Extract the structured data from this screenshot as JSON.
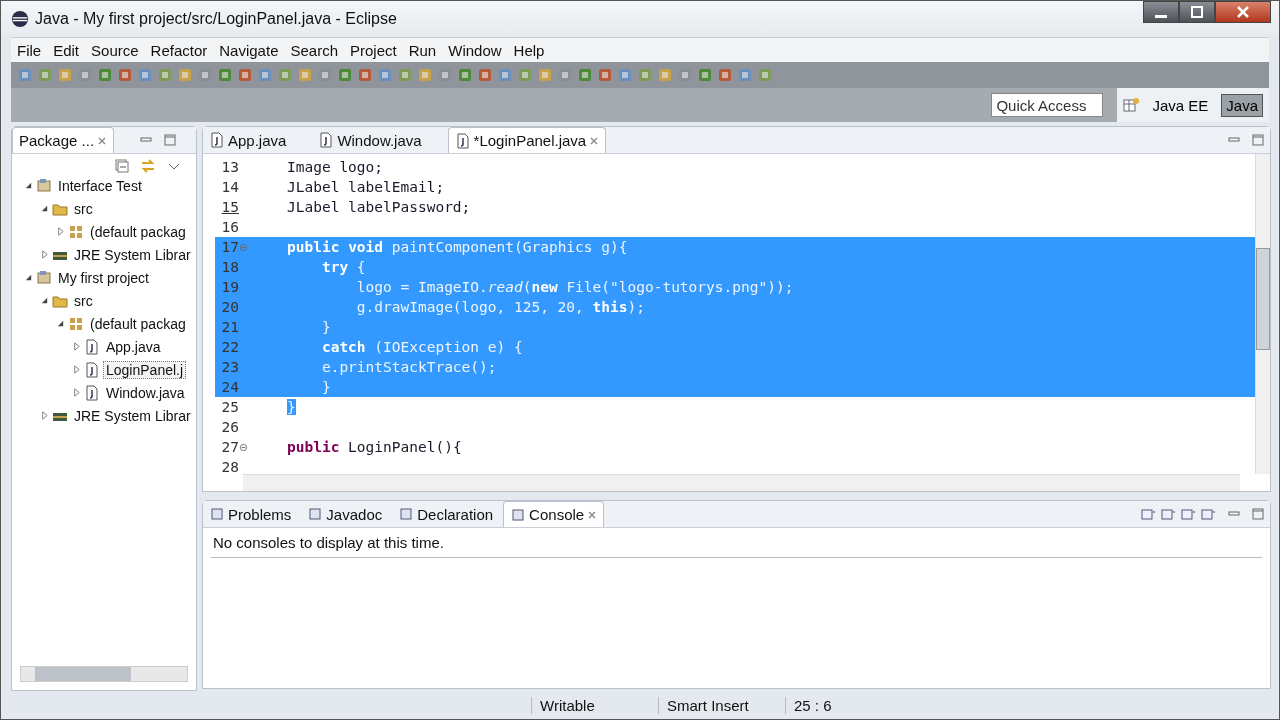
{
  "window": {
    "title": "Java - My first project/src/LoginPanel.java - Eclipse"
  },
  "menu": [
    "File",
    "Edit",
    "Source",
    "Refactor",
    "Navigate",
    "Search",
    "Project",
    "Run",
    "Window",
    "Help"
  ],
  "quick_access": {
    "placeholder": "Quick Access"
  },
  "perspectives": [
    {
      "label": "Java EE",
      "selected": false
    },
    {
      "label": "Java",
      "selected": true
    }
  ],
  "package_explorer": {
    "title": "Package ...",
    "tree": [
      {
        "label": "Interface Test",
        "kind": "project",
        "expanded": true,
        "selected": false,
        "children": [
          {
            "label": "src",
            "kind": "source",
            "expanded": true,
            "selected": false,
            "children": [
              {
                "label": "(default packag",
                "kind": "package",
                "expanded": false,
                "selected": false
              }
            ]
          },
          {
            "label": "JRE System Librar",
            "kind": "library",
            "expanded": false,
            "selected": false
          }
        ]
      },
      {
        "label": "My first project",
        "kind": "project",
        "expanded": true,
        "selected": false,
        "children": [
          {
            "label": "src",
            "kind": "source",
            "expanded": true,
            "selected": false,
            "children": [
              {
                "label": "(default packag",
                "kind": "package",
                "expanded": true,
                "selected": false,
                "children": [
                  {
                    "label": "App.java",
                    "kind": "file",
                    "expanded": false,
                    "selected": false
                  },
                  {
                    "label": "LoginPanel.j",
                    "kind": "file",
                    "expanded": false,
                    "selected": true
                  },
                  {
                    "label": "Window.java",
                    "kind": "file",
                    "expanded": false,
                    "selected": false
                  }
                ]
              }
            ]
          },
          {
            "label": "JRE System Librar",
            "kind": "library",
            "expanded": false,
            "selected": false
          }
        ]
      }
    ]
  },
  "editor": {
    "tabs": [
      {
        "label": "App.java",
        "selected": false
      },
      {
        "label": "Window.java",
        "selected": false
      },
      {
        "label": "*LoginPanel.java",
        "selected": true
      }
    ],
    "lines": [
      {
        "number": "13",
        "text": "Image logo;",
        "selected": false,
        "fold": false,
        "current": false
      },
      {
        "number": "14",
        "text": "JLabel labelEmail;",
        "selected": false,
        "fold": false,
        "current": false
      },
      {
        "number": "15",
        "text": "JLabel labelPassword;",
        "selected": false,
        "fold": false,
        "current": true
      },
      {
        "number": "16",
        "selected": false,
        "fold": false,
        "current": false
      },
      {
        "number": "17",
        "text": "**public** **void** paintComponent(Graphics g){",
        "selected": true,
        "fold": true,
        "current": false
      },
      {
        "number": "18",
        "text": "    **try** {",
        "selected": true,
        "fold": false,
        "current": false
      },
      {
        "number": "19",
        "text": "        logo = ImageIO.*read*(**new** File(\"logo-tutorys.png\"));",
        "selected": true,
        "fold": false,
        "current": false
      },
      {
        "number": "20",
        "text": "        g.drawImage(logo, 125, 20, **this**);",
        "selected": true,
        "fold": false,
        "current": false
      },
      {
        "number": "21",
        "text": "    }",
        "selected": true,
        "fold": false,
        "current": false
      },
      {
        "number": "22",
        "text": "    **catch** (IOException e) {",
        "selected": true,
        "fold": false,
        "current": false
      },
      {
        "number": "23",
        "text": "    e.printStackTrace();",
        "selected": true,
        "fold": false,
        "current": false
      },
      {
        "number": "24",
        "text": "    }",
        "selected": true,
        "fold": false,
        "current": false
      },
      {
        "number": "25",
        "text": "}",
        "selected": true,
        "fold": false,
        "current": false
      },
      {
        "number": "26",
        "selected": false,
        "fold": false,
        "current": false
      },
      {
        "number": "27",
        "text": "**public** LoginPanel(){",
        "selected": false,
        "fold": true,
        "current": false
      },
      {
        "number": "28",
        "selected": false,
        "fold": false,
        "current": false
      }
    ]
  },
  "bottom_panel": {
    "tabs": [
      {
        "label": "Problems",
        "selected": false
      },
      {
        "label": "Javadoc",
        "selected": false
      },
      {
        "label": "Declaration",
        "selected": false
      },
      {
        "label": "Console",
        "selected": true
      }
    ],
    "message": "No consoles to display at this time."
  },
  "status_bar": [
    "Writable",
    "Smart Insert",
    "25 : 6"
  ]
}
